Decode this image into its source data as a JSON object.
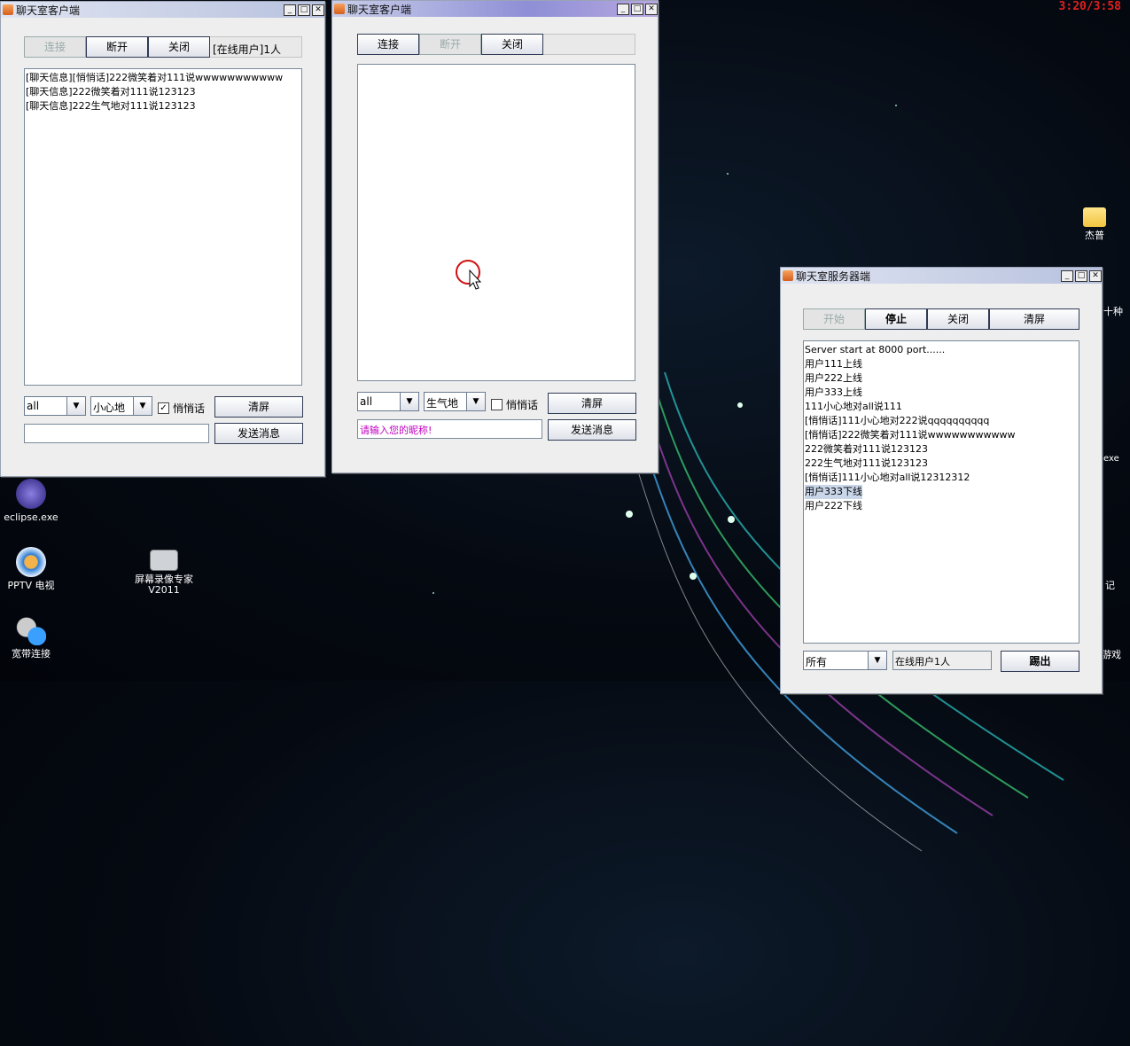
{
  "clock": "3:20/3:58",
  "desktop_icons": {
    "eclipse": "eclipse.exe",
    "pptv": "PPTV 电视",
    "recorder": "屏幕录像专家V2011",
    "broadband": "宽带连接",
    "folder": "杰普",
    "partial1": "十种",
    "partial2": "exe",
    "partial3": "记",
    "partial4": "游戏"
  },
  "client1": {
    "title": "聊天室客户端",
    "connect": "连接",
    "disconnect": "断开",
    "close": "关闭",
    "online": "[在线用户]1人",
    "messages": [
      "[聊天信息][悄悄话]222微笑着对111说wwwwwwwwwww",
      "[聊天信息]222微笑着对111说123123",
      "[聊天信息]222生气地对111说123123"
    ],
    "target": "all",
    "mood": "小心地",
    "whisper_label": "悄悄话",
    "whisper_checked": true,
    "clear": "清屏",
    "send": "发送消息",
    "input_value": ""
  },
  "client2": {
    "title": "聊天室客户端",
    "connect": "连接",
    "disconnect": "断开",
    "close": "关闭",
    "target": "all",
    "mood": "生气地",
    "whisper_label": "悄悄话",
    "whisper_checked": false,
    "clear": "清屏",
    "send": "发送消息",
    "input_placeholder": "请输入您的昵称!"
  },
  "server": {
    "title": "聊天室服务器端",
    "start": "开始",
    "stop": "停止",
    "close": "关闭",
    "clear": "清屏",
    "log": [
      "Server start at 8000 port......",
      "用户111上线",
      "用户222上线",
      "用户333上线",
      "111小心地对all说111",
      "[悄悄话]111小心地对222说qqqqqqqqqq",
      "[悄悄话]222微笑着对111说wwwwwwwwwww",
      "222微笑着对111说123123",
      "222生气地对111说123123",
      "[悄悄话]111小心地对all说12312312",
      "用户333下线",
      "用户222下线"
    ],
    "highlight_index": 10,
    "user_select": "所有",
    "online": "在线用户1人",
    "kick": "踢出"
  },
  "colors": {
    "placeholder": "#c000c0",
    "clock": "#e02020"
  }
}
